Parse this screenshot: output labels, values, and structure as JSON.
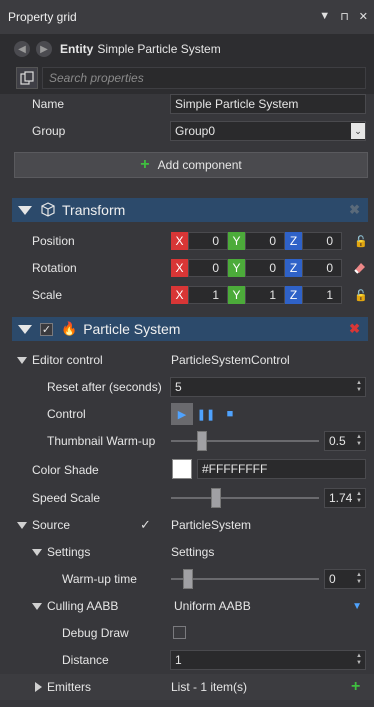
{
  "window": {
    "title": "Property grid"
  },
  "entity": {
    "type_label": "Entity",
    "name": "Simple Particle System"
  },
  "search": {
    "placeholder": "Search properties"
  },
  "fields": {
    "name_label": "Name",
    "name_value": "Simple Particle System",
    "group_label": "Group",
    "group_value": "Group0"
  },
  "add_component_label": "Add component",
  "transform": {
    "title": "Transform",
    "position": {
      "label": "Position",
      "x": "0",
      "y": "0",
      "z": "0"
    },
    "rotation": {
      "label": "Rotation",
      "x": "0",
      "y": "0",
      "z": "0"
    },
    "scale": {
      "label": "Scale",
      "x": "1",
      "y": "1",
      "z": "1"
    }
  },
  "particle": {
    "title": "Particle System",
    "editor_control_label": "Editor control",
    "editor_control_value": "ParticleSystemControl",
    "reset_after_label": "Reset after (seconds)",
    "reset_after_value": "5",
    "control_label": "Control",
    "thumbnail_warmup_label": "Thumbnail Warm-up",
    "thumbnail_warmup_value": "0.5",
    "thumbnail_warmup_fraction": 0.1,
    "color_shade_label": "Color Shade",
    "color_shade_value": "#FFFFFFFF",
    "speed_scale_label": "Speed Scale",
    "speed_scale_value": "1.74",
    "speed_scale_fraction": 0.2,
    "source_label": "Source",
    "source_value": "ParticleSystem",
    "settings_label": "Settings",
    "settings_value": "Settings",
    "warmup_label": "Warm-up time",
    "warmup_value": "0",
    "warmup_fraction": 0.0,
    "culling_label": "Culling AABB",
    "culling_value": "Uniform AABB",
    "debug_draw_label": "Debug Draw",
    "distance_label": "Distance",
    "distance_value": "1",
    "emitters_label": "Emitters",
    "emitters_value": "List - 1 item(s)"
  },
  "axes": {
    "x": "X",
    "y": "Y",
    "z": "Z"
  },
  "colors": {
    "section_header": "#2c4a6b",
    "axis_x": "#d83636",
    "axis_y": "#4cab3a",
    "axis_z": "#2f62c8",
    "add_green": "#3fbf3f"
  }
}
